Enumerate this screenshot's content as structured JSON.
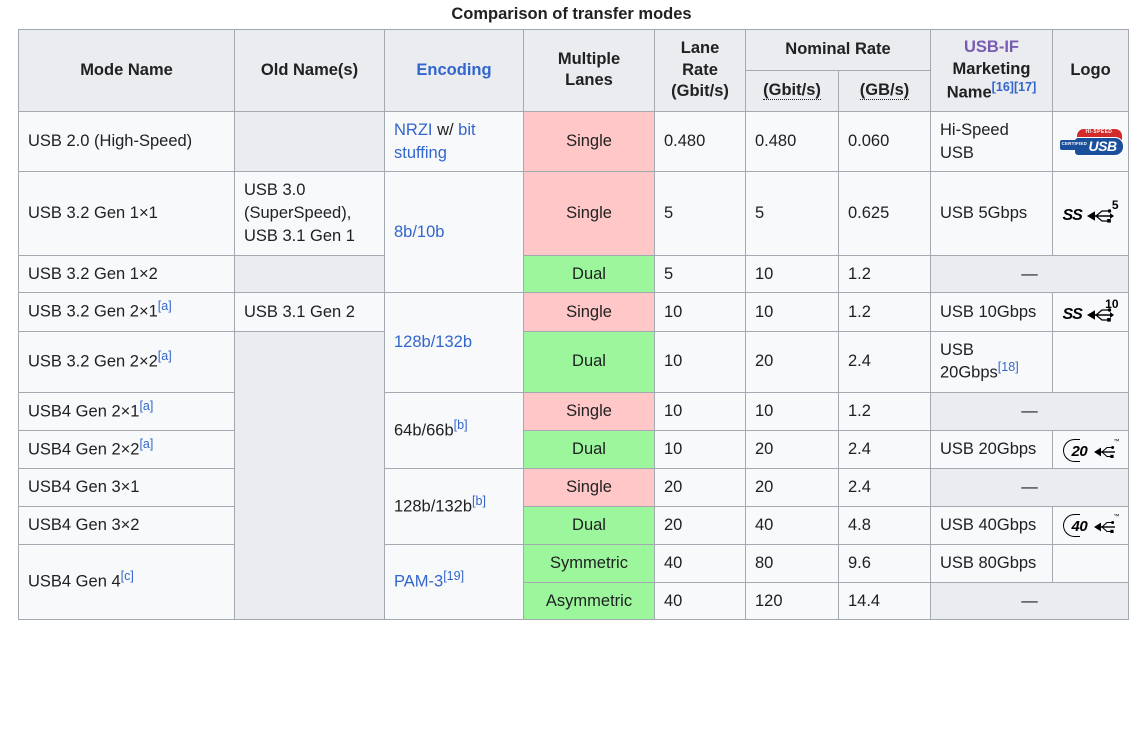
{
  "caption": "Comparison of transfer modes",
  "colors": {
    "header_bg": "#eaecf0",
    "cell_bg": "#f8f9fa",
    "single_lane_bg": "#ffc7c7",
    "multi_lane_bg": "#9cf79c",
    "empty_bg": "#eaecf0",
    "link": "#3366cc",
    "visited_link": "#795cb2",
    "border": "#a2a9b1"
  },
  "headers": {
    "mode_name": "Mode Name",
    "old_names": "Old Name(s)",
    "encoding": "Encoding",
    "multiple_lanes_line1": "Multiple",
    "multiple_lanes_line2": "Lanes",
    "lane_rate_line1": "Lane",
    "lane_rate_line2": "Rate",
    "lane_rate_line3": "(Gbit/s)",
    "nominal_rate": "Nominal Rate",
    "nominal_gbit": "(Gbit/s)",
    "nominal_gb": "(GB/s)",
    "usb_if": "USB-IF",
    "marketing_name": "Marketing",
    "marketing_name2": "Name",
    "marketing_refs": [
      "[16]",
      "[17]"
    ],
    "logo": "Logo"
  },
  "rows": [
    {
      "mode": "USB 2.0 (High-Speed)",
      "mode_ref": "",
      "old": "",
      "old_empty": true,
      "encoding": "NRZI w/ bit stuffing",
      "encoding_ref": "",
      "encoding_link": true,
      "lanes": "Single",
      "lane_rate": "0.480",
      "gbit": "0.480",
      "gb": "0.060",
      "marketing": "Hi-Speed USB",
      "logo": "hi-speed-usb"
    },
    {
      "mode": "USB 3.2 Gen 1×1",
      "mode_ref": "",
      "old": "USB 3.0 (SuperSpeed), USB 3.1 Gen 1",
      "old_empty": false,
      "encoding": "8b/10b",
      "encoding_ref": "",
      "encoding_link": true,
      "lanes": "Single",
      "lane_rate": "5",
      "gbit": "5",
      "gb": "0.625",
      "marketing": "USB 5Gbps",
      "logo": "ss-5"
    },
    {
      "mode": "USB 3.2 Gen 1×2",
      "mode_ref": "",
      "old": "",
      "old_empty": true,
      "encoding": "",
      "encoding_ref": "",
      "encoding_link": true,
      "lanes": "Dual",
      "lane_rate": "5",
      "gbit": "10",
      "gb": "1.2",
      "marketing": "—",
      "logo": ""
    },
    {
      "mode": "USB 3.2 Gen 2×1",
      "mode_ref": "[a]",
      "old": "USB 3.1 Gen 2",
      "old_empty": false,
      "encoding": "128b/132b",
      "encoding_ref": "",
      "encoding_link": true,
      "lanes": "Single",
      "lane_rate": "10",
      "gbit": "10",
      "gb": "1.2",
      "marketing": "USB 10Gbps",
      "logo": "ss-10"
    },
    {
      "mode": "USB 3.2 Gen 2×2",
      "mode_ref": "[a]",
      "old": "",
      "old_empty": true,
      "encoding": "",
      "encoding_ref": "",
      "encoding_link": true,
      "lanes": "Dual",
      "lane_rate": "10",
      "gbit": "20",
      "gb": "2.4",
      "marketing": "USB 20Gbps",
      "marketing_ref": "[18]",
      "logo": ""
    },
    {
      "mode": "USB4 Gen 2×1",
      "mode_ref": "[a]",
      "old": "",
      "old_empty": true,
      "encoding": "64b/66b",
      "encoding_ref": "[b]",
      "encoding_link": false,
      "lanes": "Single",
      "lane_rate": "10",
      "gbit": "10",
      "gb": "1.2",
      "marketing": "—",
      "logo": ""
    },
    {
      "mode": "USB4 Gen 2×2",
      "mode_ref": "[a]",
      "old": "",
      "old_empty": true,
      "encoding": "",
      "encoding_ref": "",
      "encoding_link": false,
      "lanes": "Dual",
      "lane_rate": "10",
      "gbit": "20",
      "gb": "2.4",
      "marketing": "USB 20Gbps",
      "logo": "num-20"
    },
    {
      "mode": "USB4 Gen 3×1",
      "mode_ref": "",
      "old": "",
      "old_empty": true,
      "encoding": "128b/132b",
      "encoding_ref": "[b]",
      "encoding_link": false,
      "lanes": "Single",
      "lane_rate": "20",
      "gbit": "20",
      "gb": "2.4",
      "marketing": "—",
      "logo": ""
    },
    {
      "mode": "USB4 Gen 3×2",
      "mode_ref": "",
      "old": "",
      "old_empty": true,
      "encoding": "",
      "encoding_ref": "",
      "encoding_link": false,
      "lanes": "Dual",
      "lane_rate": "20",
      "gbit": "40",
      "gb": "4.8",
      "marketing": "USB 40Gbps",
      "logo": "num-40"
    },
    {
      "mode": "USB4 Gen 4",
      "mode_ref": "[c]",
      "old": "",
      "old_empty": true,
      "encoding": "PAM-3",
      "encoding_ref": "[19]",
      "encoding_link": true,
      "lanes": "Symmetric",
      "lane_rate": "40",
      "gbit": "80",
      "gb": "9.6",
      "marketing": "USB 80Gbps",
      "logo": ""
    },
    {
      "mode": "",
      "mode_ref": "",
      "old": "",
      "old_empty": true,
      "encoding": "",
      "encoding_ref": "",
      "encoding_link": true,
      "lanes": "Asymmetric",
      "lane_rate": "40",
      "gbit": "120",
      "gb": "14.4",
      "marketing": "—",
      "logo": ""
    }
  ],
  "encoding_cells": {
    "nrzi": "NRZI",
    "wslash": " w/ ",
    "bitstuffing": "bit stuffing",
    "e8b10b": "8b/10b",
    "e128b132b": "128b/132b",
    "e64b66b": "64b/66b",
    "e128b132b_b": "128b/132b",
    "ref_b": "[b]",
    "pam3": "PAM-3",
    "ref19": "[19]"
  },
  "logo_labels": {
    "ss": "SS",
    "five": "5",
    "ten": "10",
    "twenty": "20",
    "forty": "40",
    "tm": "™",
    "certified": "CERTIFIED",
    "hispeed": "HI-SPEED",
    "usb": "USB"
  }
}
